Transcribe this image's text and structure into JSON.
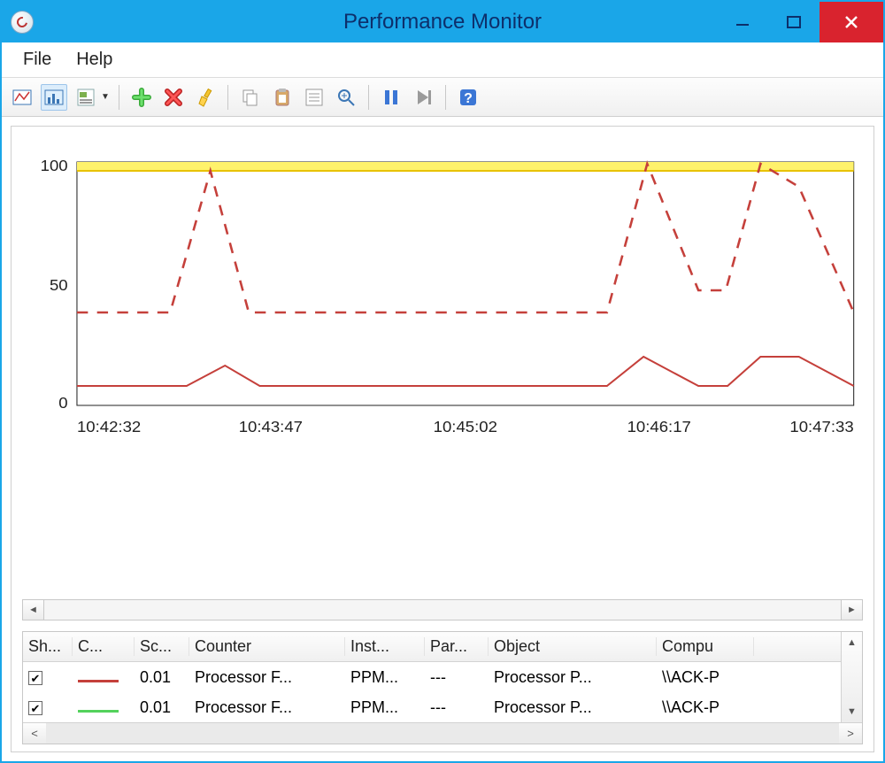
{
  "window": {
    "title": "Performance Monitor"
  },
  "menu": {
    "file": "File",
    "help": "Help"
  },
  "toolbar": {
    "buttons": [
      {
        "name": "view-line-icon"
      },
      {
        "name": "view-histogram-icon"
      },
      {
        "name": "view-report-icon"
      },
      {
        "name": "dropdown-caret-icon"
      },
      {
        "name": "add-counter-icon"
      },
      {
        "name": "delete-counter-icon"
      },
      {
        "name": "highlight-icon"
      },
      {
        "name": "copy-icon"
      },
      {
        "name": "paste-icon"
      },
      {
        "name": "properties-icon"
      },
      {
        "name": "zoom-icon"
      },
      {
        "name": "freeze-icon"
      },
      {
        "name": "update-data-icon"
      },
      {
        "name": "help-icon"
      }
    ]
  },
  "chart_data": {
    "type": "line",
    "title": "",
    "xlabel": "",
    "ylabel": "",
    "ylim": [
      0,
      100
    ],
    "yticks": [
      0,
      50,
      100
    ],
    "x_labels": [
      "10:42:32",
      "10:43:47",
      "10:45:02",
      "10:46:17",
      "10:47:33"
    ],
    "x_positions": [
      0,
      25,
      50,
      75,
      100
    ],
    "series": [
      {
        "name": "Processor Frequency (dashed red)",
        "style": "dashed",
        "color": "#c5403b",
        "x": [
          0,
          12,
          17,
          22,
          68,
          73,
          80,
          83,
          88,
          93,
          100
        ],
        "y": [
          38,
          38,
          95,
          38,
          38,
          100,
          48,
          48,
          100,
          90,
          38
        ]
      },
      {
        "name": "Processor Frequency (solid red)",
        "style": "solid",
        "color": "#c5403b",
        "x": [
          0,
          14,
          19,
          24,
          68,
          72,
          80,
          84,
          88,
          92,
          100
        ],
        "y": [
          8,
          8,
          17,
          8,
          8,
          20,
          8,
          8,
          20,
          20,
          8
        ]
      },
      {
        "name": "Processor Frequency (green)",
        "style": "solid",
        "color": "#54d25c",
        "visible_segment": true,
        "x": [
          0,
          100
        ],
        "y": [
          100,
          100
        ]
      }
    ]
  },
  "counters": {
    "headers": {
      "show": "Sh...",
      "color": "C...",
      "scale": "Sc...",
      "counter": "Counter",
      "instance": "Inst...",
      "parent": "Par...",
      "object": "Object",
      "computer": "Compu"
    },
    "rows": [
      {
        "show_checked": true,
        "color": "#c5403b",
        "scale": "0.01",
        "counter": "Processor F...",
        "instance": "PPM...",
        "parent": "---",
        "object": "Processor P...",
        "computer": "\\\\ACK-P"
      },
      {
        "show_checked": true,
        "color": "#54d25c",
        "scale": "0.01",
        "counter": "Processor F...",
        "instance": "PPM...",
        "parent": "---",
        "object": "Processor P...",
        "computer": "\\\\ACK-P"
      }
    ]
  }
}
